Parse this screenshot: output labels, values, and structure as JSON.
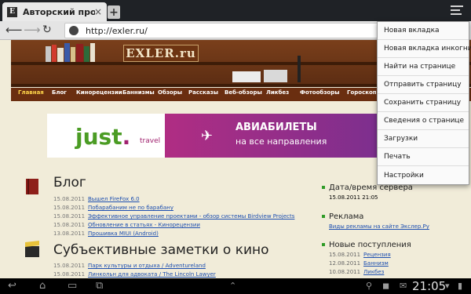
{
  "tab": {
    "title": "Авторский проек…",
    "favicon": "E",
    "close": "×"
  },
  "new_tab": "+",
  "address_bar": {
    "url": "http://exler.ru/"
  },
  "site": {
    "logo": "EXLER.ru",
    "nav": [
      "Главная",
      "Блог",
      "Кинорецензии",
      "Баннизмы",
      "Обзоры",
      "Рассказы",
      "Веб-обзоры",
      "Ликбез",
      "Фотообзоры",
      "Гороскоп"
    ]
  },
  "ad": {
    "brand": "just",
    "brand_dot": ".",
    "brand_sub": "travel",
    "line1": "АВИАБИЛЕТЫ",
    "line2": "на все направления"
  },
  "blog": {
    "title": "Блог",
    "items": [
      {
        "date": "15.08.2011",
        "text": "Вышел FireFox 6.0"
      },
      {
        "date": "15.08.2011",
        "text": "Побарабаним не по барабану"
      },
      {
        "date": "15.08.2011",
        "text": "Эффективное управление проектами - обзор системы Birdview Projects"
      },
      {
        "date": "15.08.2011",
        "text": "Обновление в статьях - Кинорецензии"
      },
      {
        "date": "13.08.2011",
        "text": "Прошивка MIUI (Android)"
      }
    ]
  },
  "movies": {
    "title": "Субъективные заметки о кино",
    "items": [
      {
        "date": "15.08.2011",
        "text": "Парк культуры и отдыха / Adventureland"
      },
      {
        "date": "15.08.2011",
        "text": "Линкольн для адвоката / The Lincoln Lawyer"
      }
    ]
  },
  "sidebar": {
    "server_time": {
      "heading": "Дата/время сервера",
      "value": "15.08.2011 21:05"
    },
    "ads": {
      "heading": "Реклама",
      "link": "Виды рекламы на сайте Экслер.Ру"
    },
    "new_arrivals": {
      "heading": "Новые поступления",
      "items": [
        {
          "date": "15.08.2011",
          "text": "Рецензия"
        },
        {
          "date": "12.08.2011",
          "text": "Баннизм"
        },
        {
          "date": "10.08.2011",
          "text": "Ликбез"
        }
      ]
    }
  },
  "menu": [
    "Новая вкладка",
    "Новая вкладка инкогнито",
    "Найти на странице",
    "Отправить страницу",
    "Сохранить страницу",
    "Сведения о странице",
    "Загрузки",
    "Печать",
    "Настройки"
  ],
  "status": {
    "time": "21:05"
  },
  "colors": {
    "accent_nav": "#6a2e10",
    "link": "#1d4fb0",
    "ad_purple": "#a0226f"
  }
}
